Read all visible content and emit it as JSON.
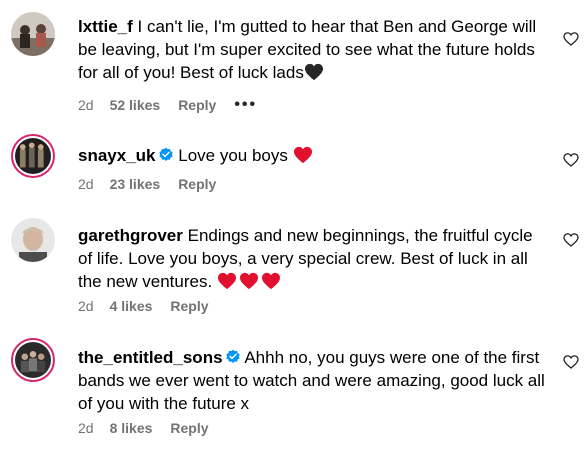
{
  "colors": {
    "text": "#000000",
    "meta": "#737373",
    "verified": "#0095f6",
    "heart_red": "#e0102e",
    "ring": "#d6246e"
  },
  "comments": [
    {
      "username": "lxttie_f",
      "text": "I can't lie, I'm gutted to hear that Ben and George will be leaving, but I'm super excited to see what the future holds for all of you! Best of luck lads",
      "emoji": "black-heart",
      "verified": false,
      "age": "2d",
      "likes": "52 likes",
      "reply": "Reply",
      "more": "•••"
    },
    {
      "username": "snayx_uk",
      "text": "Love you boys",
      "emoji": "red-heart",
      "verified": true,
      "age": "2d",
      "likes": "23 likes",
      "reply": "Reply"
    },
    {
      "username": "garethgrover",
      "text": "Endings and new beginnings, the fruitful cycle of life. Love you boys, a very special crew. Best of luck in all the new ventures.",
      "emoji": "red-heart x3",
      "verified": false,
      "age": "2d",
      "likes": "4 likes",
      "reply": "Reply"
    },
    {
      "username": "the_entitled_sons",
      "text": "Ahhh no, you guys were one of the first bands we ever went to watch and were amazing, good luck all of you with the future x",
      "verified": true,
      "age": "2d",
      "likes": "8 likes",
      "reply": "Reply"
    }
  ]
}
